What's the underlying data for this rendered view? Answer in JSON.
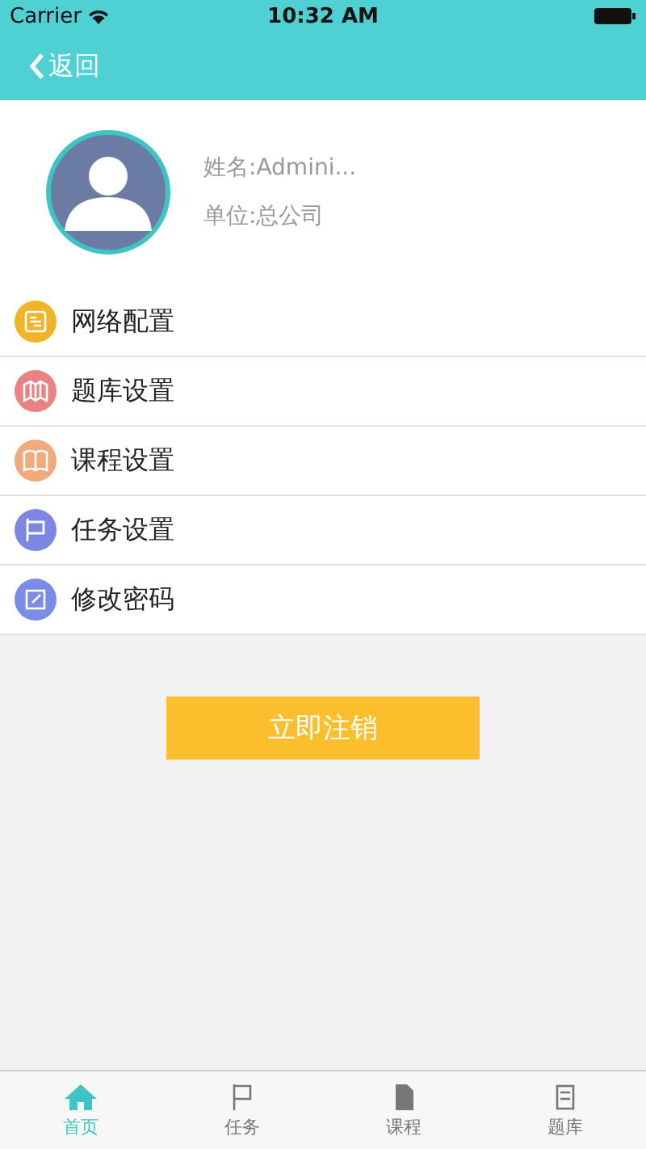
{
  "status_bar": {
    "carrier": "Carrier",
    "time": "10:32 AM"
  },
  "nav": {
    "back": "返回"
  },
  "profile": {
    "name": "姓名:Admini...",
    "unit": "单位:总公司"
  },
  "menu": [
    {
      "label": "网络配置",
      "kind": "network",
      "color": "#f0b429"
    },
    {
      "label": "题库设置",
      "kind": "map",
      "color": "#e98282"
    },
    {
      "label": "课程设置",
      "kind": "book",
      "color": "#f0aa7c"
    },
    {
      "label": "任务设置",
      "kind": "flag",
      "color": "#7b87e0"
    },
    {
      "label": "修改密码",
      "kind": "edit",
      "color": "#7b8ce8"
    }
  ],
  "logout_button": "立即注销",
  "tabs": [
    {
      "label": "首页",
      "kind": "home",
      "selected": true
    },
    {
      "label": "任务",
      "kind": "flag",
      "selected": false
    },
    {
      "label": "课程",
      "kind": "doc",
      "selected": false
    },
    {
      "label": "题库",
      "kind": "bank",
      "selected": false
    }
  ]
}
